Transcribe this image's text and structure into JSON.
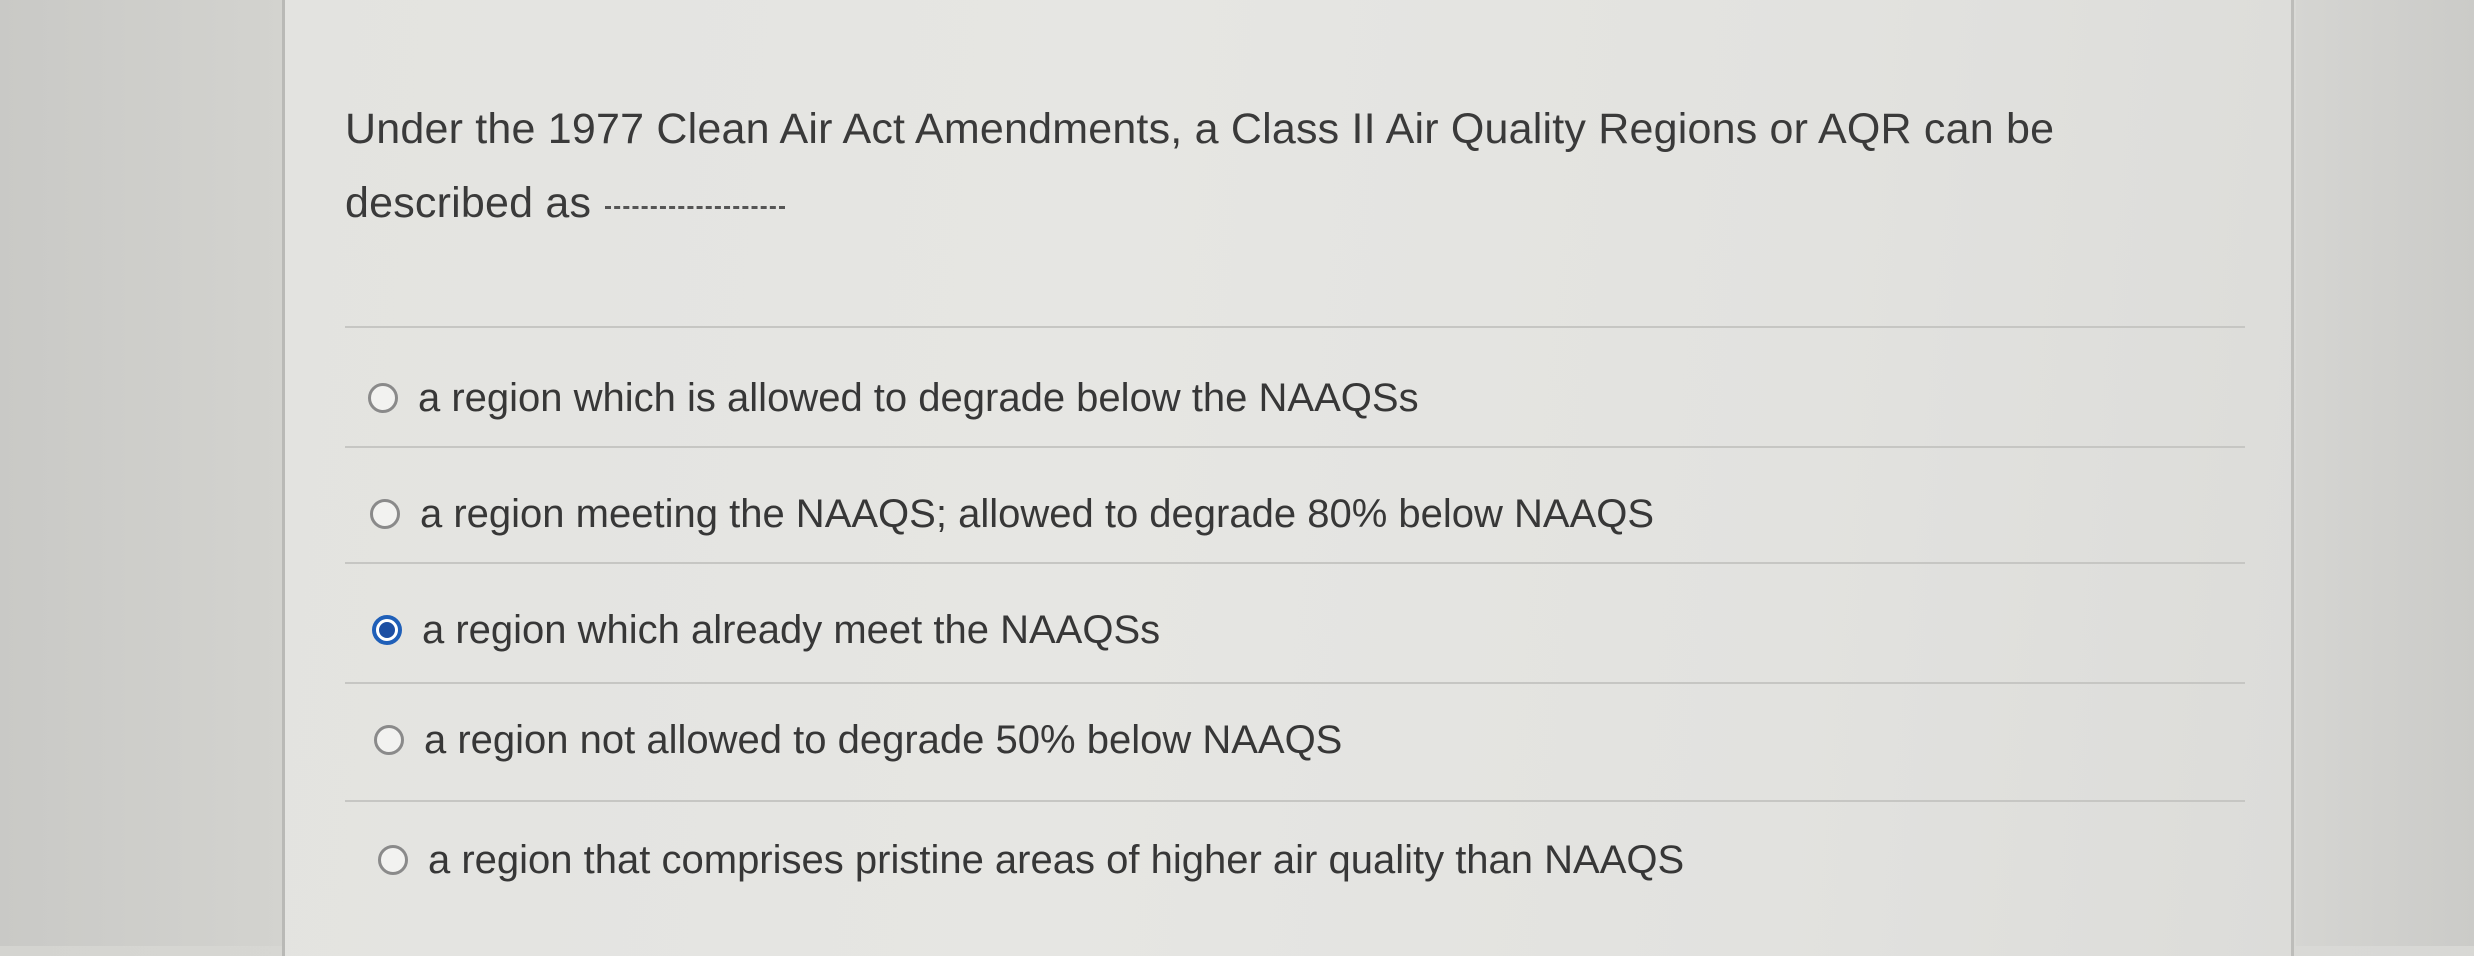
{
  "question": {
    "line1": "Under the 1977 Clean Air Act Amendments, a Class II Air Quality Regions or AQR can be",
    "line2": "described as"
  },
  "options": [
    {
      "label": "a region which is allowed to degrade below the NAAQSs",
      "selected": false
    },
    {
      "label": "a region meeting the NAAQS; allowed to degrade 80% below NAAQS",
      "selected": false
    },
    {
      "label": "a region which already meet the NAAQSs",
      "selected": true
    },
    {
      "label": "a region not allowed to degrade 50% below NAAQS",
      "selected": false
    },
    {
      "label": "a region that comprises pristine areas of higher air quality than NAAQS",
      "selected": false
    }
  ],
  "colors": {
    "selected_radio": "#1f5fb8",
    "text": "#3a3a3a"
  }
}
